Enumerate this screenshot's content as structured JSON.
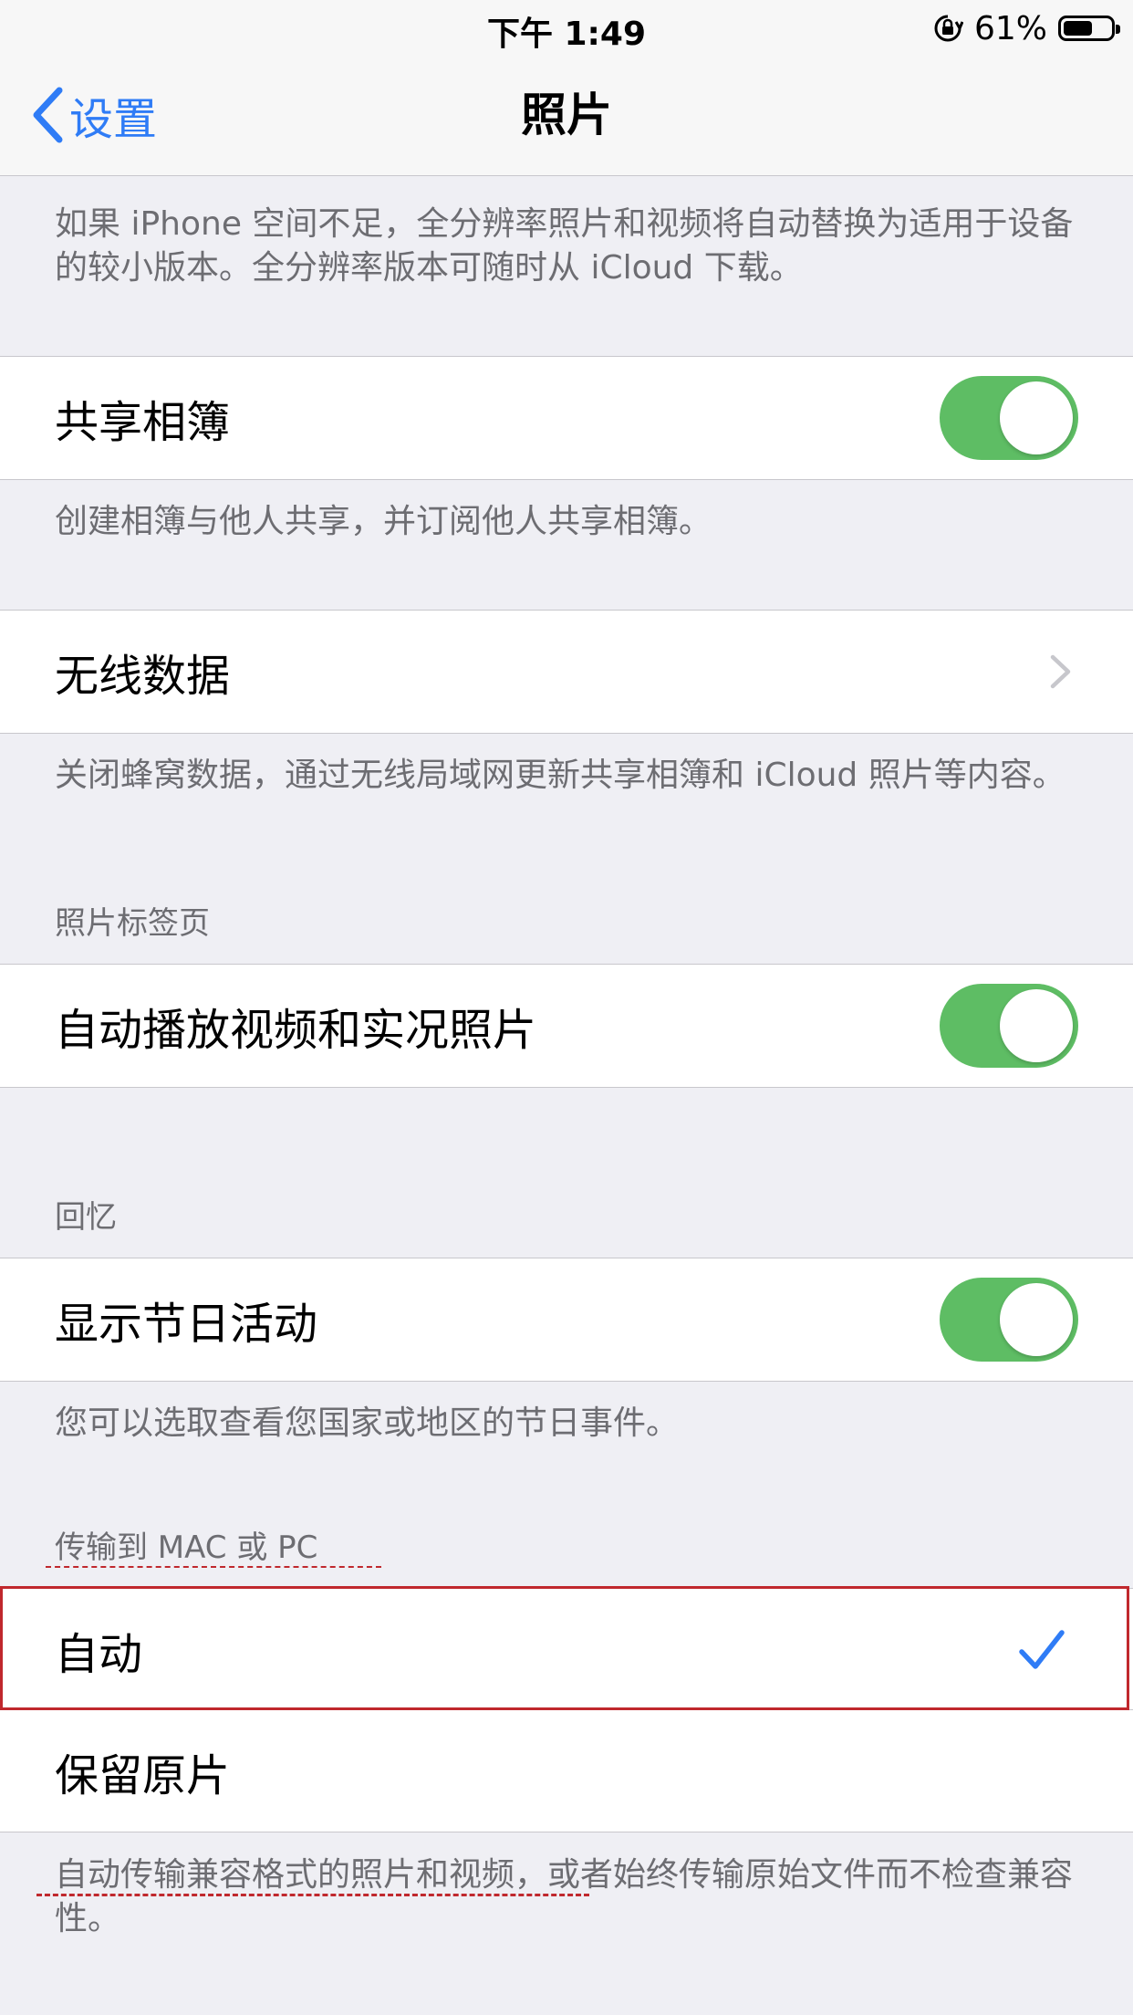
{
  "status_bar": {
    "time": "下午 1:49",
    "battery_text": "61%",
    "battery_level": 0.61
  },
  "nav": {
    "back_label": "设置",
    "title": "照片"
  },
  "top_footer": "如果 iPhone 空间不足，全分辨率照片和视频将自动替换为适用于设备的较小版本。全分辨率版本可随时从 iCloud 下载。",
  "shared_albums": {
    "label": "共享相簿",
    "on": true,
    "footer": "创建相簿与他人共享，并订阅他人共享相簿。"
  },
  "wireless_data": {
    "label": "无线数据",
    "footer": "关闭蜂窝数据，通过无线局域网更新共享相簿和 iCloud 照片等内容。"
  },
  "photos_tab": {
    "header": "照片标签页",
    "autoplay_label": "自动播放视频和实况照片",
    "autoplay_on": true
  },
  "memories": {
    "header": "回忆",
    "holiday_label": "显示节日活动",
    "holiday_on": true,
    "footer": "您可以选取查看您国家或地区的节日事件。"
  },
  "transfer": {
    "header": "传输到 MAC 或 PC",
    "options": [
      {
        "label": "自动",
        "selected": true
      },
      {
        "label": "保留原片",
        "selected": false
      }
    ],
    "footer": "自动传输兼容格式的照片和视频，或者始终传输原始文件而不检查兼容性。"
  },
  "colors": {
    "tint": "#2f7cf6",
    "toggle_on": "#5ebd64",
    "annotation_red": "#c0282d"
  }
}
